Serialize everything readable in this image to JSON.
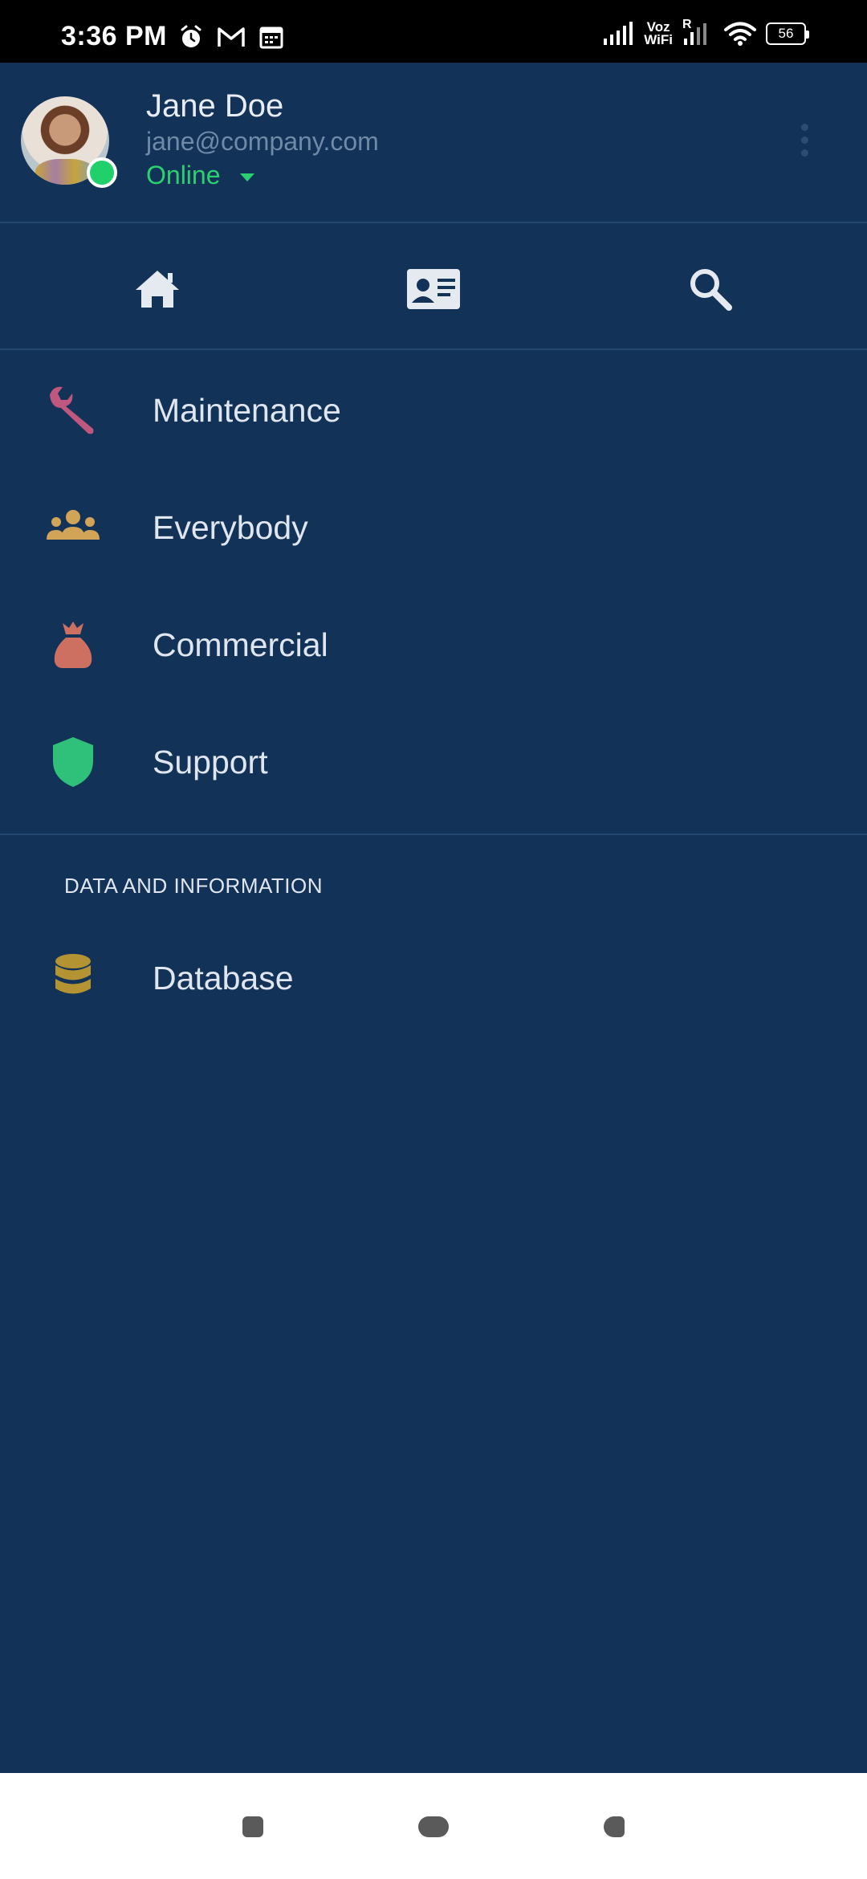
{
  "status_bar": {
    "time": "3:36 PM",
    "icons_left": [
      "alarm-icon",
      "gmail-icon",
      "calendar-icon"
    ],
    "voz_top": "Voz",
    "voz_bottom": "WiFi",
    "roaming": "R",
    "battery": "56"
  },
  "profile": {
    "name": "Jane Doe",
    "email": "jane@company.com",
    "status": "Online",
    "status_color": "#2bd070"
  },
  "tabs": [
    {
      "icon": "home-icon"
    },
    {
      "icon": "contact-card-icon"
    },
    {
      "icon": "search-icon"
    }
  ],
  "menu": {
    "items": [
      {
        "label": "Maintenance",
        "icon": "wrench-icon",
        "color": "#c0577f"
      },
      {
        "label": "Everybody",
        "icon": "people-icon",
        "color": "#d2a457"
      },
      {
        "label": "Commercial",
        "icon": "money-bag-icon",
        "color": "#cd6f61"
      },
      {
        "label": "Support",
        "icon": "shield-icon",
        "color": "#2fc079"
      }
    ],
    "section_title": "DATA AND INFORMATION",
    "section_items": [
      {
        "label": "Database",
        "icon": "database-icon",
        "color": "#b39332"
      }
    ]
  },
  "theme": {
    "background": "#133257",
    "text": "#dfe6ef"
  }
}
